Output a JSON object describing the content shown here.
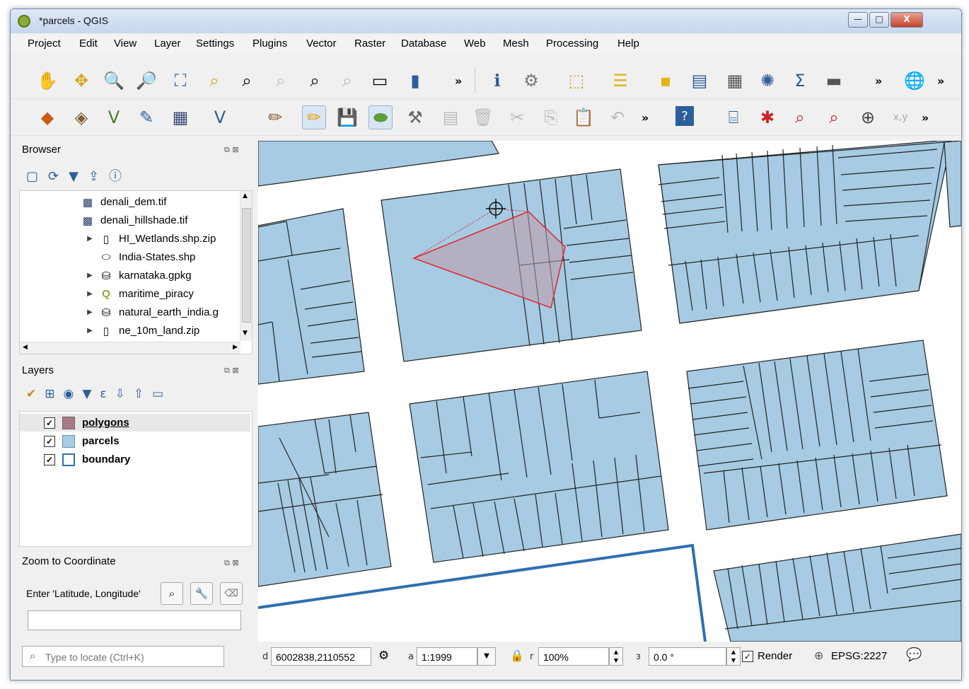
{
  "window": {
    "title": "*parcels - QGIS",
    "minimize": "—",
    "maximize": "□",
    "close": "X"
  },
  "menubar": [
    "Project",
    "Edit",
    "View",
    "Layer",
    "Settings",
    "Plugins",
    "Vector",
    "Raster",
    "Database",
    "Web",
    "Mesh",
    "Processing",
    "Help"
  ],
  "toolbar": {
    "overflow": "»"
  },
  "browser": {
    "title": "Browser",
    "items": [
      {
        "label": "denali_dem.tif",
        "icon": "raster-icon",
        "expandable": false
      },
      {
        "label": "denali_hillshade.tif",
        "icon": "raster-icon",
        "expandable": false
      },
      {
        "label": "HI_Wetlands.shp.zip",
        "icon": "zip-icon",
        "expandable": true
      },
      {
        "label": "India-States.shp",
        "icon": "polygon-layer-icon",
        "expandable": false
      },
      {
        "label": "karnataka.gpkg",
        "icon": "database-icon",
        "expandable": true
      },
      {
        "label": "maritime_piracy",
        "icon": "qgis-project-icon",
        "expandable": true
      },
      {
        "label": "natural_earth_india.g",
        "icon": "database-icon",
        "expandable": true
      },
      {
        "label": "ne_10m_land.zip",
        "icon": "zip-icon",
        "expandable": true
      }
    ]
  },
  "layers": {
    "title": "Layers",
    "items": [
      {
        "label": "polygons",
        "checked": "✓",
        "swatch": "#a77a86"
      },
      {
        "label": "parcels",
        "checked": "✓",
        "swatch": "#a6cbe3"
      },
      {
        "label": "boundary",
        "checked": "✓",
        "swatch": "#ffffff"
      }
    ]
  },
  "zoom": {
    "title": "Zoom to Coordinate",
    "prompt": "Enter 'Latitude, Longitude'",
    "input_value": ""
  },
  "status": {
    "locator_placeholder": "Type to locate (Ctrl+K)",
    "coord_label": "d",
    "coordinate": "6002838,2110552",
    "scale_label": "a",
    "scale": "1:1999",
    "magnifier_label": "r",
    "magnifier": "100%",
    "rotation_label": "з",
    "rotation": "0.0 °",
    "render_label": "Render",
    "render_checked": "✓",
    "crs": "EPSG:2227"
  },
  "colors": {
    "parcel_fill": "#a6cbe3",
    "parcel_stroke": "#222222",
    "boundary_stroke": "#2f6fae",
    "sketch_stroke": "#e0242f"
  }
}
